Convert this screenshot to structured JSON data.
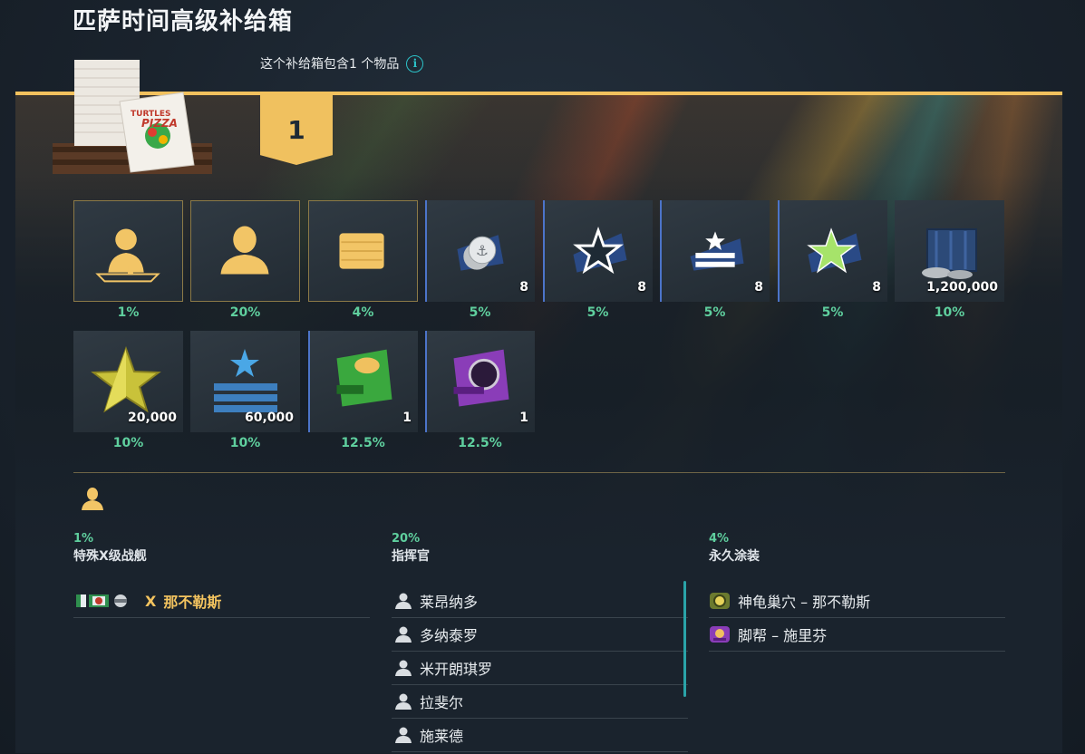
{
  "title": "匹萨时间高级补给箱",
  "contains_text": "这个补给箱包含1 个物品",
  "info_icon": "info-icon",
  "slot_number": "1",
  "colors": {
    "accent_gold": "#f2c15d",
    "percent_green": "#5fcf9e",
    "ship_gold": "#f4c45f",
    "scroll_teal": "#2aa3a8"
  },
  "tiles_row1": [
    {
      "icon": "special-ship-silhouette-icon",
      "count": "",
      "pct": "1%"
    },
    {
      "icon": "commander-silhouette-icon",
      "count": "",
      "pct": "20%"
    },
    {
      "icon": "permanent-camouflage-icon",
      "count": "",
      "pct": "4%"
    },
    {
      "icon": "anchor-coins-icon",
      "count": "8",
      "pct": "5%"
    },
    {
      "icon": "white-star-icon",
      "count": "8",
      "pct": "5%"
    },
    {
      "icon": "star-stripes-icon",
      "count": "8",
      "pct": "5%"
    },
    {
      "icon": "green-star-icon",
      "count": "8",
      "pct": "5%"
    },
    {
      "icon": "credits-crate-icon",
      "count": "1,200,000",
      "pct": "10%"
    }
  ],
  "tiles_row2": [
    {
      "icon": "gold-star-icon",
      "count": "20,000",
      "pct": "10%"
    },
    {
      "icon": "blue-star-bars-icon",
      "count": "60,000",
      "pct": "10%"
    },
    {
      "icon": "turtle-camouflage-icon",
      "count": "1",
      "pct": "12.5%"
    },
    {
      "icon": "purple-camouflage-icon",
      "count": "1",
      "pct": "12.5%"
    }
  ],
  "section_icon": "commander-silhouette-icon",
  "columns": [
    {
      "pct": "1%",
      "name": "特殊X级战舰",
      "ship_tier": "X",
      "ship_name": "那不勒斯"
    },
    {
      "pct": "20%",
      "name": "指挥官",
      "items": [
        "莱昂纳多",
        "多纳泰罗",
        "米开朗琪罗",
        "拉斐尔",
        "施莱德"
      ]
    },
    {
      "pct": "4%",
      "name": "永久涂装",
      "items": [
        "神龟巢穴 – 那不勒斯",
        "脚帮 – 施里芬"
      ]
    }
  ]
}
